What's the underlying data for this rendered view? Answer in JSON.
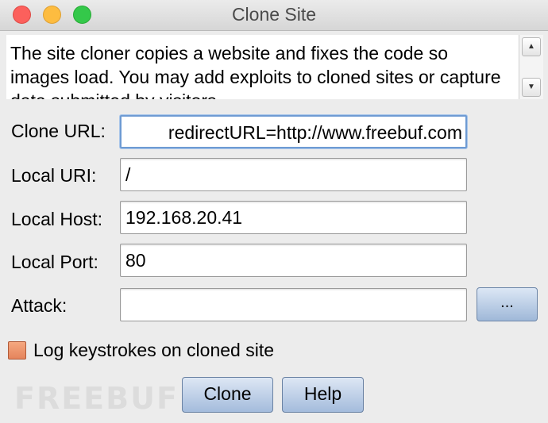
{
  "window": {
    "title": "Clone Site"
  },
  "description": {
    "text": "The site cloner copies a website and fixes the code so images load. You may add exploits to cloned sites or capture data submitted by visitors"
  },
  "scrollbar": {
    "up_icon": "▲",
    "down_icon": "▼"
  },
  "form": {
    "clone_url": {
      "label": "Clone URL:",
      "value": "redirectURL=http://www.freebuf.com"
    },
    "local_uri": {
      "label": "Local URI:",
      "value": "/"
    },
    "local_host": {
      "label": "Local Host:",
      "value": "192.168.20.41"
    },
    "local_port": {
      "label": "Local Port:",
      "value": "80"
    },
    "attack": {
      "label": "Attack:",
      "value": "",
      "browse_label": "..."
    }
  },
  "options": {
    "log_keystrokes": {
      "label": "Log keystrokes on cloned site",
      "checked": false
    }
  },
  "buttons": {
    "clone": "Clone",
    "help": "Help"
  },
  "watermark": {
    "text": "FREEBUF"
  },
  "colors": {
    "close": "#fc605c",
    "minimize": "#fdbc40",
    "maximize": "#34c84a",
    "checkbox": "#e5845c",
    "button_accent": "#a4bcdc"
  }
}
